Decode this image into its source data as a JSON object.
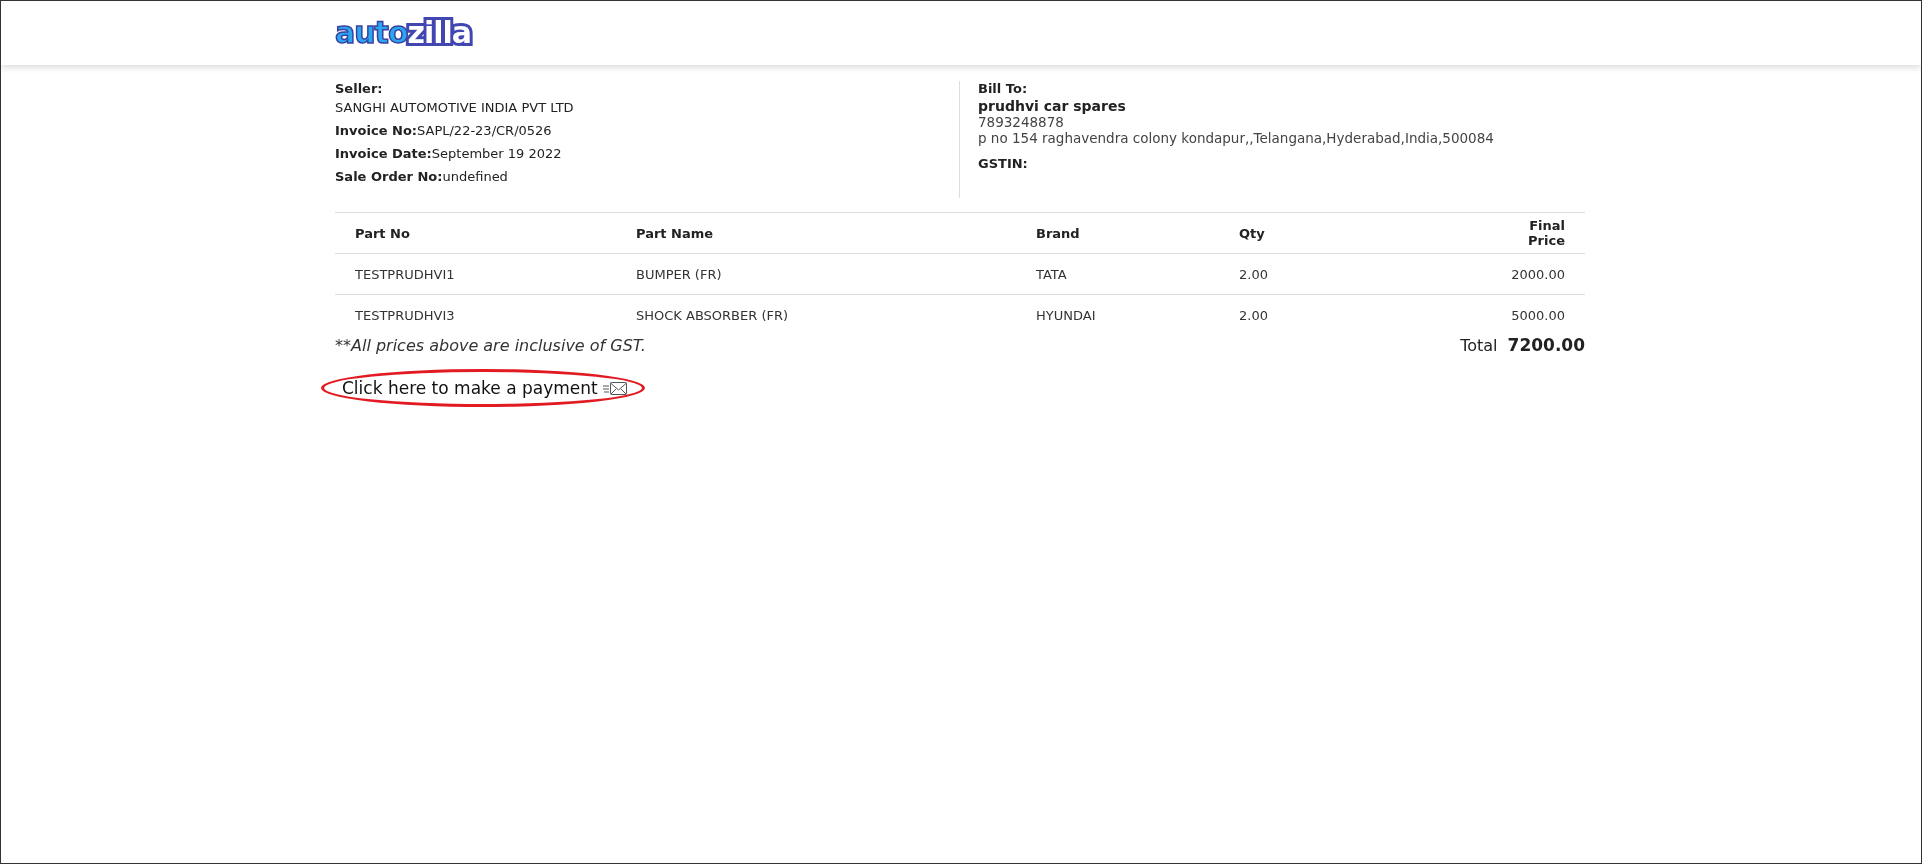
{
  "logo": {
    "part_1": "auto",
    "part_2": "zilla"
  },
  "seller": {
    "label": "Seller:",
    "name": "SANGHI AUTOMOTIVE INDIA PVT LTD",
    "fields": [
      {
        "label": "Invoice No:",
        "value": "SAPL/22-23/CR/0526"
      },
      {
        "label": "Invoice Date:",
        "value": "September 19 2022"
      },
      {
        "label": "Sale Order No:",
        "value": "undefined"
      }
    ]
  },
  "bill_to": {
    "label": "Bill To:",
    "name": "prudhvi car spares",
    "phone": "7893248878",
    "address": "p no 154 raghavendra colony kondapur,,Telangana,Hyderabad,India,500084",
    "gstin_label": "GSTIN:"
  },
  "table": {
    "columns": [
      "Part No",
      "Part Name",
      "Brand",
      "Qty",
      "Final Price"
    ],
    "rows": [
      [
        "TESTPRUDHVI1",
        "BUMPER (FR)",
        "TATA",
        "2.00",
        "2000.00"
      ],
      [
        "TESTPRUDHVI3",
        "SHOCK ABSORBER (FR)",
        "HYUNDAI",
        "2.00",
        "5000.00"
      ]
    ]
  },
  "note": "**All prices above are inclusive of GST.",
  "total": {
    "label": "Total",
    "value": "7200.00"
  },
  "payment_link": "Click here to make a payment"
}
